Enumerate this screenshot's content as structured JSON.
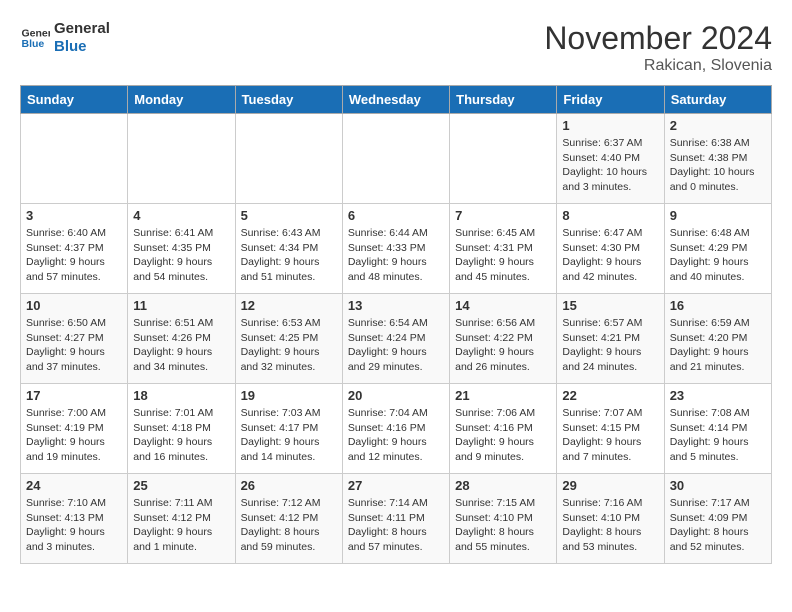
{
  "logo": {
    "line1": "General",
    "line2": "Blue"
  },
  "title": "November 2024",
  "location": "Rakican, Slovenia",
  "weekdays": [
    "Sunday",
    "Monday",
    "Tuesday",
    "Wednesday",
    "Thursday",
    "Friday",
    "Saturday"
  ],
  "weeks": [
    [
      {
        "day": "",
        "info": ""
      },
      {
        "day": "",
        "info": ""
      },
      {
        "day": "",
        "info": ""
      },
      {
        "day": "",
        "info": ""
      },
      {
        "day": "",
        "info": ""
      },
      {
        "day": "1",
        "info": "Sunrise: 6:37 AM\nSunset: 4:40 PM\nDaylight: 10 hours\nand 3 minutes."
      },
      {
        "day": "2",
        "info": "Sunrise: 6:38 AM\nSunset: 4:38 PM\nDaylight: 10 hours\nand 0 minutes."
      }
    ],
    [
      {
        "day": "3",
        "info": "Sunrise: 6:40 AM\nSunset: 4:37 PM\nDaylight: 9 hours\nand 57 minutes."
      },
      {
        "day": "4",
        "info": "Sunrise: 6:41 AM\nSunset: 4:35 PM\nDaylight: 9 hours\nand 54 minutes."
      },
      {
        "day": "5",
        "info": "Sunrise: 6:43 AM\nSunset: 4:34 PM\nDaylight: 9 hours\nand 51 minutes."
      },
      {
        "day": "6",
        "info": "Sunrise: 6:44 AM\nSunset: 4:33 PM\nDaylight: 9 hours\nand 48 minutes."
      },
      {
        "day": "7",
        "info": "Sunrise: 6:45 AM\nSunset: 4:31 PM\nDaylight: 9 hours\nand 45 minutes."
      },
      {
        "day": "8",
        "info": "Sunrise: 6:47 AM\nSunset: 4:30 PM\nDaylight: 9 hours\nand 42 minutes."
      },
      {
        "day": "9",
        "info": "Sunrise: 6:48 AM\nSunset: 4:29 PM\nDaylight: 9 hours\nand 40 minutes."
      }
    ],
    [
      {
        "day": "10",
        "info": "Sunrise: 6:50 AM\nSunset: 4:27 PM\nDaylight: 9 hours\nand 37 minutes."
      },
      {
        "day": "11",
        "info": "Sunrise: 6:51 AM\nSunset: 4:26 PM\nDaylight: 9 hours\nand 34 minutes."
      },
      {
        "day": "12",
        "info": "Sunrise: 6:53 AM\nSunset: 4:25 PM\nDaylight: 9 hours\nand 32 minutes."
      },
      {
        "day": "13",
        "info": "Sunrise: 6:54 AM\nSunset: 4:24 PM\nDaylight: 9 hours\nand 29 minutes."
      },
      {
        "day": "14",
        "info": "Sunrise: 6:56 AM\nSunset: 4:22 PM\nDaylight: 9 hours\nand 26 minutes."
      },
      {
        "day": "15",
        "info": "Sunrise: 6:57 AM\nSunset: 4:21 PM\nDaylight: 9 hours\nand 24 minutes."
      },
      {
        "day": "16",
        "info": "Sunrise: 6:59 AM\nSunset: 4:20 PM\nDaylight: 9 hours\nand 21 minutes."
      }
    ],
    [
      {
        "day": "17",
        "info": "Sunrise: 7:00 AM\nSunset: 4:19 PM\nDaylight: 9 hours\nand 19 minutes."
      },
      {
        "day": "18",
        "info": "Sunrise: 7:01 AM\nSunset: 4:18 PM\nDaylight: 9 hours\nand 16 minutes."
      },
      {
        "day": "19",
        "info": "Sunrise: 7:03 AM\nSunset: 4:17 PM\nDaylight: 9 hours\nand 14 minutes."
      },
      {
        "day": "20",
        "info": "Sunrise: 7:04 AM\nSunset: 4:16 PM\nDaylight: 9 hours\nand 12 minutes."
      },
      {
        "day": "21",
        "info": "Sunrise: 7:06 AM\nSunset: 4:16 PM\nDaylight: 9 hours\nand 9 minutes."
      },
      {
        "day": "22",
        "info": "Sunrise: 7:07 AM\nSunset: 4:15 PM\nDaylight: 9 hours\nand 7 minutes."
      },
      {
        "day": "23",
        "info": "Sunrise: 7:08 AM\nSunset: 4:14 PM\nDaylight: 9 hours\nand 5 minutes."
      }
    ],
    [
      {
        "day": "24",
        "info": "Sunrise: 7:10 AM\nSunset: 4:13 PM\nDaylight: 9 hours\nand 3 minutes."
      },
      {
        "day": "25",
        "info": "Sunrise: 7:11 AM\nSunset: 4:12 PM\nDaylight: 9 hours\nand 1 minute."
      },
      {
        "day": "26",
        "info": "Sunrise: 7:12 AM\nSunset: 4:12 PM\nDaylight: 8 hours\nand 59 minutes."
      },
      {
        "day": "27",
        "info": "Sunrise: 7:14 AM\nSunset: 4:11 PM\nDaylight: 8 hours\nand 57 minutes."
      },
      {
        "day": "28",
        "info": "Sunrise: 7:15 AM\nSunset: 4:10 PM\nDaylight: 8 hours\nand 55 minutes."
      },
      {
        "day": "29",
        "info": "Sunrise: 7:16 AM\nSunset: 4:10 PM\nDaylight: 8 hours\nand 53 minutes."
      },
      {
        "day": "30",
        "info": "Sunrise: 7:17 AM\nSunset: 4:09 PM\nDaylight: 8 hours\nand 52 minutes."
      }
    ]
  ]
}
